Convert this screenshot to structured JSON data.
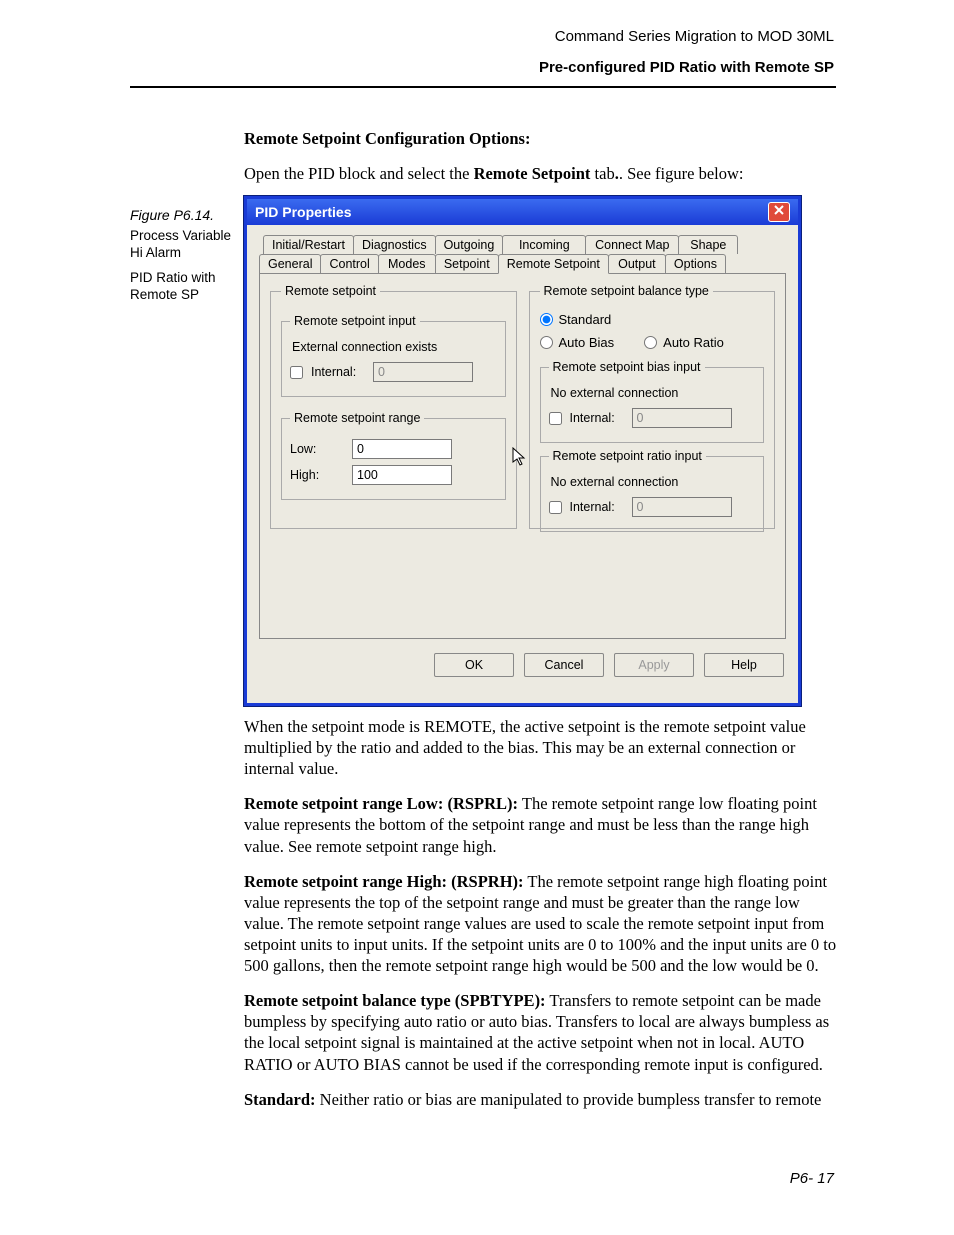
{
  "header": {
    "line1": "Command Series Migration to MOD 30ML",
    "line2": "Pre-configured PID Ratio with Remote SP"
  },
  "figure": {
    "caption": "Figure P6.14.",
    "text1": "Process Variable Hi Alarm",
    "text2": "PID Ratio with Remote SP"
  },
  "intro": {
    "heading": "Remote Setpoint Configuration Options:",
    "open_a": "Open the PID block and select the ",
    "open_b": "Remote Setpoint",
    "open_c": " tab",
    "open_d": ". See figure below:"
  },
  "dialog": {
    "title": "PID Properties",
    "tabs_row1": [
      "Initial/Restart",
      "Diagnostics",
      "Outgoing",
      "Incoming",
      "Connect Map",
      "Shape"
    ],
    "tabs_row2": [
      "General",
      "Control",
      "Modes",
      "Setpoint",
      "Remote Setpoint",
      "Output",
      "Options"
    ],
    "active_tab_index_row2": 4,
    "left": {
      "group_label": "Remote setpoint",
      "input_group_label": "Remote setpoint input",
      "ext_note": "External connection exists",
      "internal_label": "Internal:",
      "internal_value": "0",
      "range_group_label": "Remote setpoint range",
      "low_label": "Low:",
      "low_value": "0",
      "high_label": "High:",
      "high_value": "100"
    },
    "right": {
      "group_label": "Remote setpoint balance type",
      "standard": "Standard",
      "auto_bias": "Auto Bias",
      "auto_ratio": "Auto Ratio",
      "bias_group_label": "Remote setpoint bias input",
      "bias_note": "No external connection",
      "bias_internal_label": "Internal:",
      "bias_internal_value": "0",
      "ratio_group_label": "Remote setpoint ratio input",
      "ratio_note": "No external connection",
      "ratio_internal_label": "Internal:",
      "ratio_internal_value": "0"
    },
    "buttons": {
      "ok": "OK",
      "cancel": "Cancel",
      "apply": "Apply",
      "help": "Help"
    }
  },
  "paras": {
    "p1": "When the setpoint mode is REMOTE, the active setpoint is the remote setpoint value multiplied by the ratio and added to the bias.  This may be an external connection or internal value.",
    "p2b": "Remote setpoint range Low: (RSPRL):",
    "p2": " The remote setpoint range low floating point value represents the bottom of the setpoint range and must be less than the range high value.  See remote setpoint range high.",
    "p3b": "Remote setpoint range High: (RSPRH):",
    "p3": " The remote setpoint range high floating point value represents the top of the setpoint range and must be greater than the range low value.  The remote setpoint range values are used to scale the remote setpoint input from setpoint units to input units.  If the setpoint units are 0 to 100% and the input units are 0 to 500 gallons, then the remote setpoint range high would be 500 and the low would be 0.",
    "p4b": "Remote setpoint balance type (SPBTYPE):",
    "p4": " Transfers to remote setpoint can be made bumpless by specifying auto ratio or auto bias.  Transfers to local are always bumpless as the local setpoint signal is maintained at the active setpoint when not in local.  AUTO RATIO or AUTO BIAS cannot be used if the corresponding remote input is configured.",
    "p5b": "Standard:",
    "p5": "  Neither ratio or bias are manipulated to provide bumpless transfer to remote"
  },
  "page_num": "P6- 17"
}
